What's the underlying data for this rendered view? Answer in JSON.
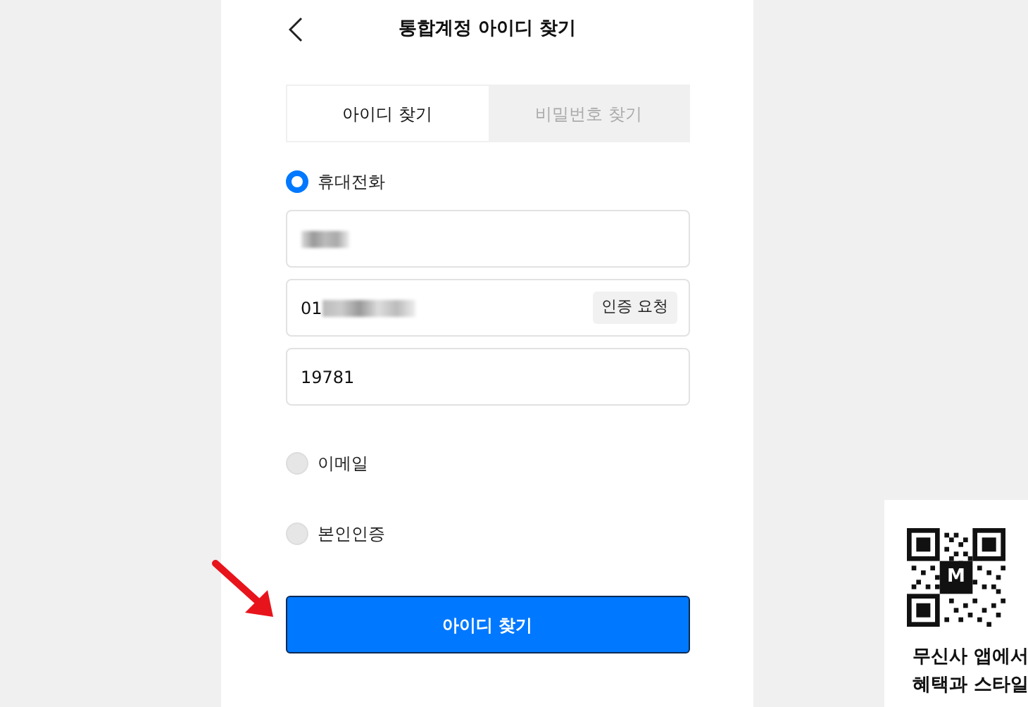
{
  "header": {
    "title": "통합계정 아이디 찾기"
  },
  "tabs": [
    {
      "label": "아이디 찾기",
      "selected": true
    },
    {
      "label": "비밀번호 찾기",
      "selected": false
    }
  ],
  "methods": [
    {
      "label": "휴대전화",
      "selected": true,
      "fields": [
        {
          "kind": "blurred"
        },
        {
          "kind": "phone",
          "value": "01",
          "button": "인증 요청"
        },
        {
          "kind": "text",
          "value": "19781"
        }
      ]
    },
    {
      "label": "이메일",
      "selected": false
    },
    {
      "label": "본인인증",
      "selected": false
    }
  ],
  "submit": "아이디 찾기",
  "promo": {
    "qr_logo": "M",
    "lines": [
      "무신사 앱에서",
      "혜택과 스타일"
    ]
  }
}
